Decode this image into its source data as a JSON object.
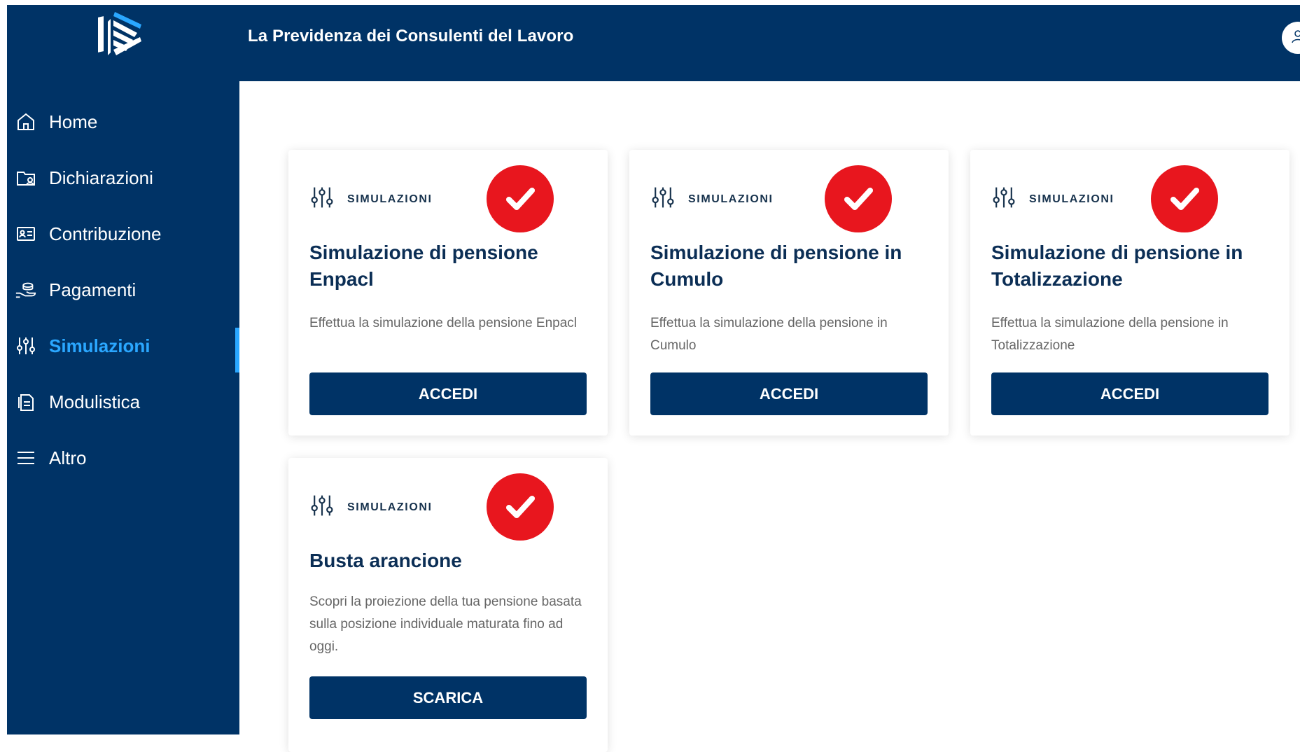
{
  "header": {
    "title": "La Previdenza dei Consulenti del Lavoro"
  },
  "user": {
    "icon": "user-icon"
  },
  "sidebar": {
    "items": [
      {
        "label": "Home",
        "icon": "home-icon",
        "active": false
      },
      {
        "label": "Dichiarazioni",
        "icon": "folder-user-icon",
        "active": false
      },
      {
        "label": "Contribuzione",
        "icon": "id-card-icon",
        "active": false
      },
      {
        "label": "Pagamenti",
        "icon": "hand-coins-icon",
        "active": false
      },
      {
        "label": "Simulazioni",
        "icon": "sliders-icon",
        "active": true
      },
      {
        "label": "Modulistica",
        "icon": "document-icon",
        "active": false
      },
      {
        "label": "Altro",
        "icon": "menu-icon",
        "active": false
      }
    ]
  },
  "cards": [
    {
      "category": "SIMULAZIONI",
      "title": "Simulazione di pensione Enpacl",
      "description": "Effettua la simulazione della pensione Enpacl",
      "button": "ACCEDI"
    },
    {
      "category": "SIMULAZIONI",
      "title": "Simulazione di pensione in Cumulo",
      "description": "Effettua la simulazione della pensione in Cumulo",
      "button": "ACCEDI"
    },
    {
      "category": "SIMULAZIONI",
      "title": "Simulazione di pensione in Totalizzazione",
      "description": "Effettua la simulazione della pensione in Totalizzazione",
      "button": "ACCEDI"
    },
    {
      "category": "SIMULAZIONI",
      "title": "Busta arancione",
      "description": "Scopri la proiezione della tua pensione basata sulla posizione individuale maturata fino ad oggi.",
      "button": "SCARICA"
    }
  ],
  "colors": {
    "brand": "#003366",
    "active": "#2aa7ff",
    "check": "#e8161e",
    "title": "#0b2e55"
  }
}
